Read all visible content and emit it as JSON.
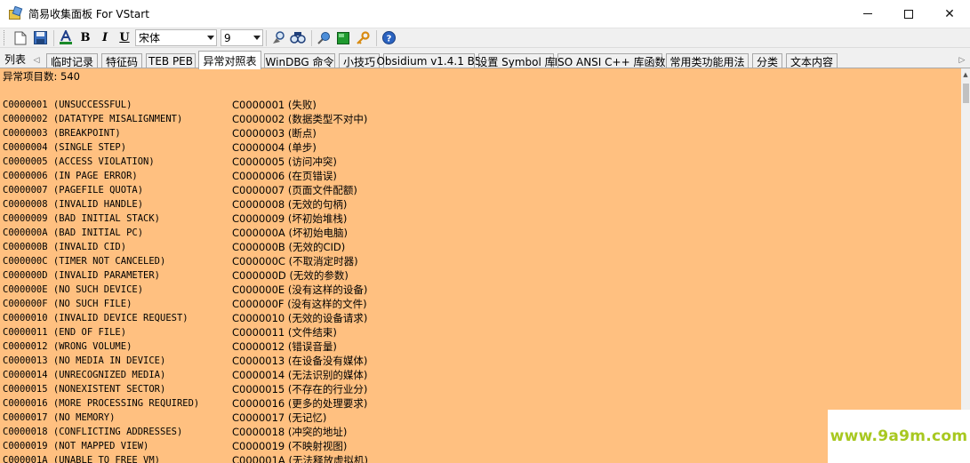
{
  "window": {
    "title": "简易收集面板 For VStart",
    "minimize_icon": "minimize-icon",
    "maximize_icon": "maximize-icon",
    "close_label": "✕"
  },
  "toolbar": {
    "bold_label": "B",
    "italic_label": "I",
    "underline_label": "U",
    "font_name": "宋体",
    "font_size": "9",
    "icons": [
      "new-file-icon",
      "save-icon",
      "font-color-icon",
      "bold-icon",
      "italic-icon",
      "underline-icon",
      "find-icon",
      "find-replace-icon",
      "pin-icon",
      "green-box-icon",
      "key-icon",
      "help-icon"
    ]
  },
  "tabs": {
    "list_label": "列表",
    "items": [
      "临时记录",
      "特征码",
      "TEB PEB",
      "异常对照表",
      "WinDBG 命令",
      "小技巧",
      "Obsidium v1.4.1 B5",
      "设置 Symbol 库",
      "ISO ANSI C++ 库函数",
      "常用类功能用法",
      "分类",
      "文本内容"
    ],
    "active_index": 3
  },
  "content": {
    "count_line": "异常项目数: 540",
    "rows": [
      {
        "en": "C0000001 (UNSUCCESSFUL)",
        "cn": "C0000001 (失败)"
      },
      {
        "en": "C0000002 (DATATYPE MISALIGNMENT)",
        "cn": "C0000002 (数据类型不对中)"
      },
      {
        "en": "C0000003 (BREAKPOINT)",
        "cn": "C0000003 (断点)"
      },
      {
        "en": "C0000004 (SINGLE STEP)",
        "cn": "C0000004 (单步)"
      },
      {
        "en": "C0000005 (ACCESS VIOLATION)",
        "cn": "C0000005 (访问冲突)"
      },
      {
        "en": "C0000006 (IN PAGE ERROR)",
        "cn": "C0000006 (在页错误)"
      },
      {
        "en": "C0000007 (PAGEFILE QUOTA)",
        "cn": "C0000007 (页面文件配额)"
      },
      {
        "en": "C0000008 (INVALID HANDLE)",
        "cn": "C0000008 (无效的句柄)"
      },
      {
        "en": "C0000009 (BAD INITIAL STACK)",
        "cn": "C0000009 (坏初始堆栈)"
      },
      {
        "en": "C000000A (BAD INITIAL PC)",
        "cn": "C000000A (坏初始电脑)"
      },
      {
        "en": "C000000B (INVALID CID)",
        "cn": "C000000B (无效的CID)"
      },
      {
        "en": "C000000C (TIMER NOT CANCELED)",
        "cn": "C000000C (不取消定时器)"
      },
      {
        "en": "C000000D (INVALID PARAMETER)",
        "cn": "C000000D (无效的参数)"
      },
      {
        "en": "C000000E (NO SUCH DEVICE)",
        "cn": "C000000E (没有这样的设备)"
      },
      {
        "en": "C000000F (NO SUCH FILE)",
        "cn": "C000000F (没有这样的文件)"
      },
      {
        "en": "C0000010 (INVALID DEVICE REQUEST)",
        "cn": "C0000010 (无效的设备请求)"
      },
      {
        "en": "C0000011 (END OF FILE)",
        "cn": "C0000011 (文件结束)"
      },
      {
        "en": "C0000012 (WRONG VOLUME)",
        "cn": "C0000012 (错误音量)"
      },
      {
        "en": "C0000013 (NO MEDIA IN DEVICE)",
        "cn": "C0000013 (在设备没有媒体)"
      },
      {
        "en": "C0000014 (UNRECOGNIZED MEDIA)",
        "cn": "C0000014 (无法识别的媒体)"
      },
      {
        "en": "C0000015 (NONEXISTENT SECTOR)",
        "cn": "C0000015 (不存在的行业分)"
      },
      {
        "en": "C0000016 (MORE PROCESSING REQUIRED)",
        "cn": "C0000016 (更多的处理要求)"
      },
      {
        "en": "C0000017 (NO MEMORY)",
        "cn": "C0000017 (无记忆)"
      },
      {
        "en": "C0000018 (CONFLICTING ADDRESSES)",
        "cn": "C0000018 (冲突的地址)"
      },
      {
        "en": "C0000019 (NOT MAPPED VIEW)",
        "cn": "C0000019 (不映射视图)"
      },
      {
        "en": "C000001A (UNABLE TO FREE VM)",
        "cn": "C000001A (无法释放虚拟机)"
      }
    ]
  },
  "watermark": {
    "text": "www.9a9m.com"
  }
}
